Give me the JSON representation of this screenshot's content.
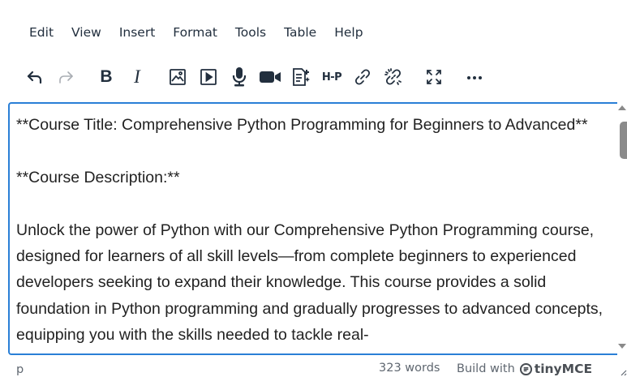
{
  "menubar": {
    "items": [
      {
        "label": "Edit"
      },
      {
        "label": "View"
      },
      {
        "label": "Insert"
      },
      {
        "label": "Format"
      },
      {
        "label": "Tools"
      },
      {
        "label": "Table"
      },
      {
        "label": "Help"
      }
    ]
  },
  "toolbar": {
    "buttons": [
      {
        "icon": "undo-icon"
      },
      {
        "icon": "redo-icon"
      },
      {
        "icon": "bold-icon",
        "label": "B"
      },
      {
        "icon": "italic-icon",
        "label": "I"
      },
      {
        "icon": "image-icon"
      },
      {
        "icon": "media-icon"
      },
      {
        "icon": "microphone-icon"
      },
      {
        "icon": "video-camera-icon"
      },
      {
        "icon": "document-add-icon"
      },
      {
        "icon": "h5p-icon",
        "label": "H-P"
      },
      {
        "icon": "link-icon"
      },
      {
        "icon": "unlink-icon"
      },
      {
        "icon": "fullscreen-icon"
      },
      {
        "icon": "more-icon"
      }
    ]
  },
  "content": {
    "paragraphs": [
      "**Course Title: Comprehensive Python Programming for Beginners to Advanced**",
      "**Course Description:**",
      "Unlock the power of Python with our Comprehensive Python Programming course, designed for learners of all skill levels—from complete beginners to experienced developers seeking to expand their knowledge. This course provides a solid foundation in Python programming and gradually progresses to advanced concepts, equipping you with the skills needed to tackle real-"
    ]
  },
  "statusbar": {
    "path": "p",
    "word_count": "323 words",
    "branding_prefix": "Build with",
    "branding_name": "tinyMCE"
  },
  "colors": {
    "focus_border": "#2a7fd6",
    "text": "#222f3e",
    "status_text": "#5f6770"
  }
}
